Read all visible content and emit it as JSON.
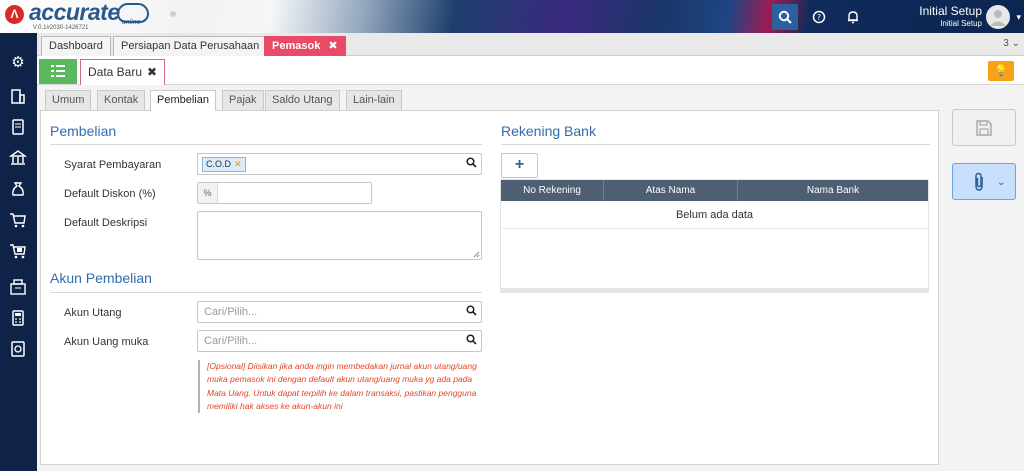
{
  "header": {
    "logo_text": "accurate",
    "logo_sub": "online",
    "version": "V.0.1#2030-1426721",
    "user_name": "Initial Setup",
    "user_role": "Initial Setup",
    "icons": [
      "search-icon",
      "help-icon",
      "bell-icon"
    ]
  },
  "sidebar": {
    "icons": [
      "gear-icon",
      "building-icon",
      "document-icon",
      "bank-icon",
      "money-bag-icon",
      "cart-icon",
      "cart-report-icon",
      "warehouse-icon",
      "calculator-icon",
      "report-icon"
    ]
  },
  "page_tabs": {
    "items": [
      {
        "label": "Dashboard"
      },
      {
        "label": "Persiapan Data Perusahaan"
      },
      {
        "label": "Pemasok"
      }
    ],
    "count": "3"
  },
  "doc": {
    "tab_label": "Data Baru"
  },
  "form_tabs": {
    "items": [
      {
        "label": "Umum"
      },
      {
        "label": "Kontak"
      },
      {
        "label": "Pembelian"
      },
      {
        "label": "Pajak"
      },
      {
        "label": "Saldo Utang"
      },
      {
        "label": "Lain-lain"
      }
    ],
    "active": "Pembelian"
  },
  "pembelian": {
    "title": "Pembelian",
    "syarat_label": "Syarat Pembayaran",
    "syarat_value": "C.O.D",
    "diskon_label": "Default Diskon (%)",
    "diskon_prefix": "%",
    "deskripsi_label": "Default Deskripsi"
  },
  "akun": {
    "title": "Akun Pembelian",
    "utang_label": "Akun Utang",
    "utang_placeholder": "Cari/Pilih...",
    "uang_muka_label": "Akun Uang muka",
    "uang_muka_placeholder": "Cari/Pilih...",
    "note": "[Opsional] Diisikan jika anda ingin membedakan jurnal akun utang/uang muka pemasok ini dengan default akun utang/uang muka yg ada pada Mata Uang. Untuk dapat terpilih ke dalam transaksi, pastikan pengguna memiliki hak akses ke akun-akun ini"
  },
  "rekening": {
    "title": "Rekening Bank",
    "add_label": "+",
    "columns": [
      "No Rekening",
      "Atas Nama",
      "Nama Bank"
    ],
    "empty_text": "Belum ada data"
  },
  "colors": {
    "accent": "#2e6db0",
    "active_tab": "#e84a68",
    "sidebar": "#0e2347",
    "list_button": "#5cb85c",
    "note_text": "#e2462a"
  }
}
